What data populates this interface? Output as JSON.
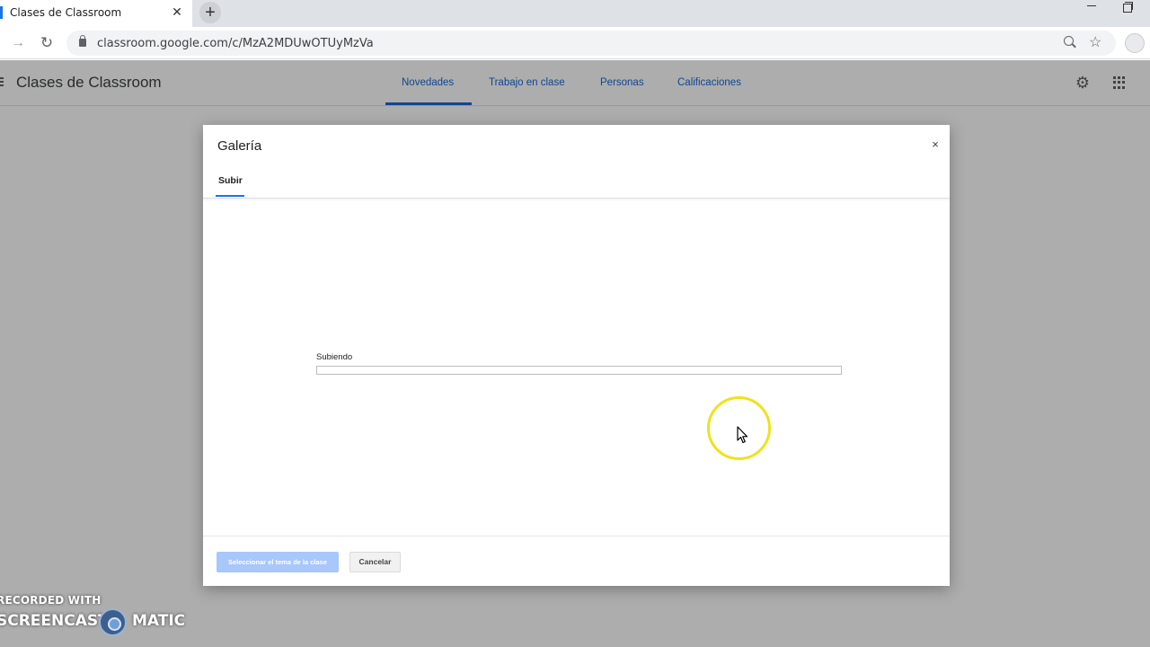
{
  "browser": {
    "tab_title": "Clases de Classroom",
    "tab_close": "✕",
    "new_tab": "+",
    "url": "classroom.google.com/c/MzA2MDUwOTUyMzVa"
  },
  "app": {
    "title": "Clases de Classroom",
    "tabs": [
      {
        "label": "Novedades",
        "active": true
      },
      {
        "label": "Trabajo en clase",
        "active": false
      },
      {
        "label": "Personas",
        "active": false
      },
      {
        "label": "Calificaciones",
        "active": false
      }
    ],
    "accent_color": "#1967d2"
  },
  "dialog": {
    "title": "Galería",
    "close": "×",
    "tab": "Subir",
    "upload_status": "Subiendo",
    "progress_percent": 0,
    "primary_button": "Seleccionar el tema de la clase",
    "secondary_button": "Cancelar"
  },
  "watermark": {
    "line1": "RECORDED WITH",
    "line2_left": "SCREENCAST",
    "line2_right": "MATIC"
  },
  "icons": {
    "forward": "forward-arrow-icon",
    "reload": "reload-icon",
    "lock": "lock-icon",
    "zoom": "zoom-icon",
    "bookmark": "star-icon",
    "settings": "gear-icon",
    "apps": "apps-grid-icon"
  }
}
